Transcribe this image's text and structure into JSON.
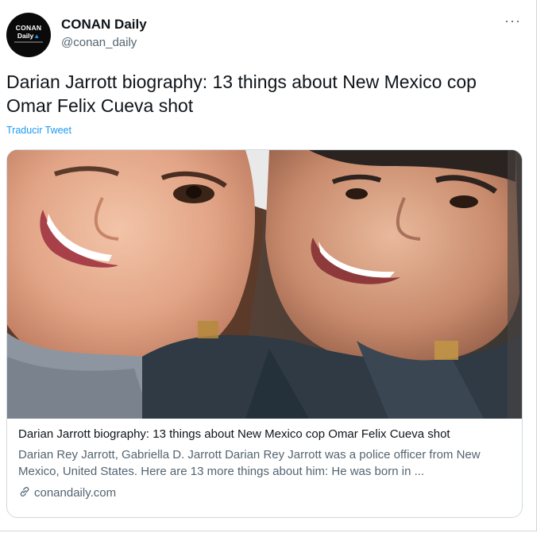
{
  "account": {
    "name": "CONAN Daily",
    "handle": "@conan_daily",
    "avatar_line1": "CONAN",
    "avatar_line2": "Daily"
  },
  "more_menu": "···",
  "tweet": {
    "text": "Darian Jarrott biography: 13 things about New Mexico cop Omar Felix Cueva shot",
    "translate_link": "Traducir Tweet"
  },
  "card": {
    "image": "selfie-photo",
    "title": "Darian Jarrott biography: 13 things about New Mexico cop Omar Felix Cueva shot",
    "description": "Darian Rey Jarrott, Gabriella D. Jarrott Darian Rey Jarrott was a police officer from New Mexico, United States. Here are 13 more things about him: He was born in ...",
    "domain": "conandaily.com",
    "link_icon": "link-icon"
  },
  "colors": {
    "accent": "#1d9bf0",
    "text": "#0f1419",
    "secondary_text": "#536471",
    "border": "#cfd9de"
  }
}
